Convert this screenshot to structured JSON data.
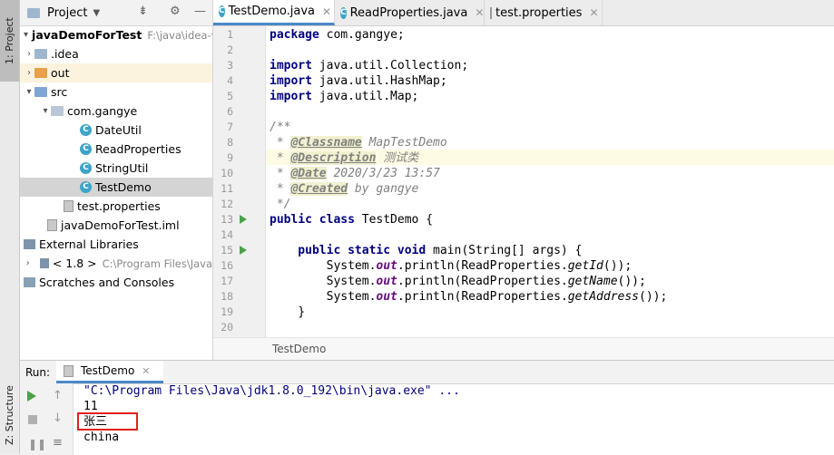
{
  "toolstrip": {
    "project_tab": "1: Project",
    "structure_tab": "Z: Structure"
  },
  "project": {
    "title": "Project",
    "tree": [
      {
        "label": "javaDemoForTest",
        "hint": "F:\\java\\idea-w"
      },
      {
        "label": ".idea"
      },
      {
        "label": "out"
      },
      {
        "label": "src"
      },
      {
        "label": "com.gangye"
      },
      {
        "label": "DateUtil"
      },
      {
        "label": "ReadProperties"
      },
      {
        "label": "StringUtil"
      },
      {
        "label": "TestDemo"
      },
      {
        "label": "test.properties"
      },
      {
        "label": "javaDemoForTest.iml"
      },
      {
        "label": "External Libraries"
      },
      {
        "label": "< 1.8 >",
        "hint": "C:\\Program Files\\Java"
      },
      {
        "label": "Scratches and Consoles"
      }
    ]
  },
  "tabs": [
    {
      "label": "TestDemo.java"
    },
    {
      "label": "ReadProperties.java"
    },
    {
      "label": "test.properties"
    }
  ],
  "editor": {
    "line_numbers": [
      "1",
      "2",
      "3",
      "4",
      "5",
      "6",
      "7",
      "8",
      "9",
      "10",
      "11",
      "12",
      "13",
      "14",
      "15",
      "16",
      "17",
      "18",
      "19",
      "20"
    ],
    "code": {
      "l1_kw": "package",
      "l1_rest": " com.gangye;",
      "l3_kw": "import",
      "l3_rest": " java.util.Collection;",
      "l4_kw": "import",
      "l4_rest": " java.util.HashMap;",
      "l5_kw": "import",
      "l5_rest": " java.util.Map;",
      "l7": "/**",
      "l8_star": " * ",
      "l8_tag": "@Classname",
      "l8_val": " MapTestDemo",
      "l9_star": " * ",
      "l9_tag": "@Description",
      "l9_val": " 测试类",
      "l10_star": " * ",
      "l10_tag": "@Date",
      "l10_val": " 2020/3/23 13:57",
      "l11_star": " * ",
      "l11_tag": "@Created",
      "l11_val": " by gangye",
      "l12": " */",
      "l13_kw": "public class",
      "l13_rest": " TestDemo {",
      "l15_kw": "    public static void",
      "l15_rest": " main(String[] args) {",
      "sys": "        System.",
      "out_field": "out",
      "println_open": ".println(ReadProperties.",
      "l16_method": "getId",
      "l17_method": "getName",
      "l18_method": "getAddress",
      "close_call": "());",
      "l19": "    }"
    }
  },
  "breadcrumb": "TestDemo",
  "run": {
    "label": "Run:",
    "tab": "TestDemo",
    "output": [
      "\"C:\\Program Files\\Java\\jdk1.8.0_192\\bin\\java.exe\" ...",
      "11",
      "张三",
      "china"
    ]
  },
  "colors": {
    "accent": "#4a88c7",
    "highlight_box": "#e02020",
    "run_green": "#4aa14a"
  }
}
